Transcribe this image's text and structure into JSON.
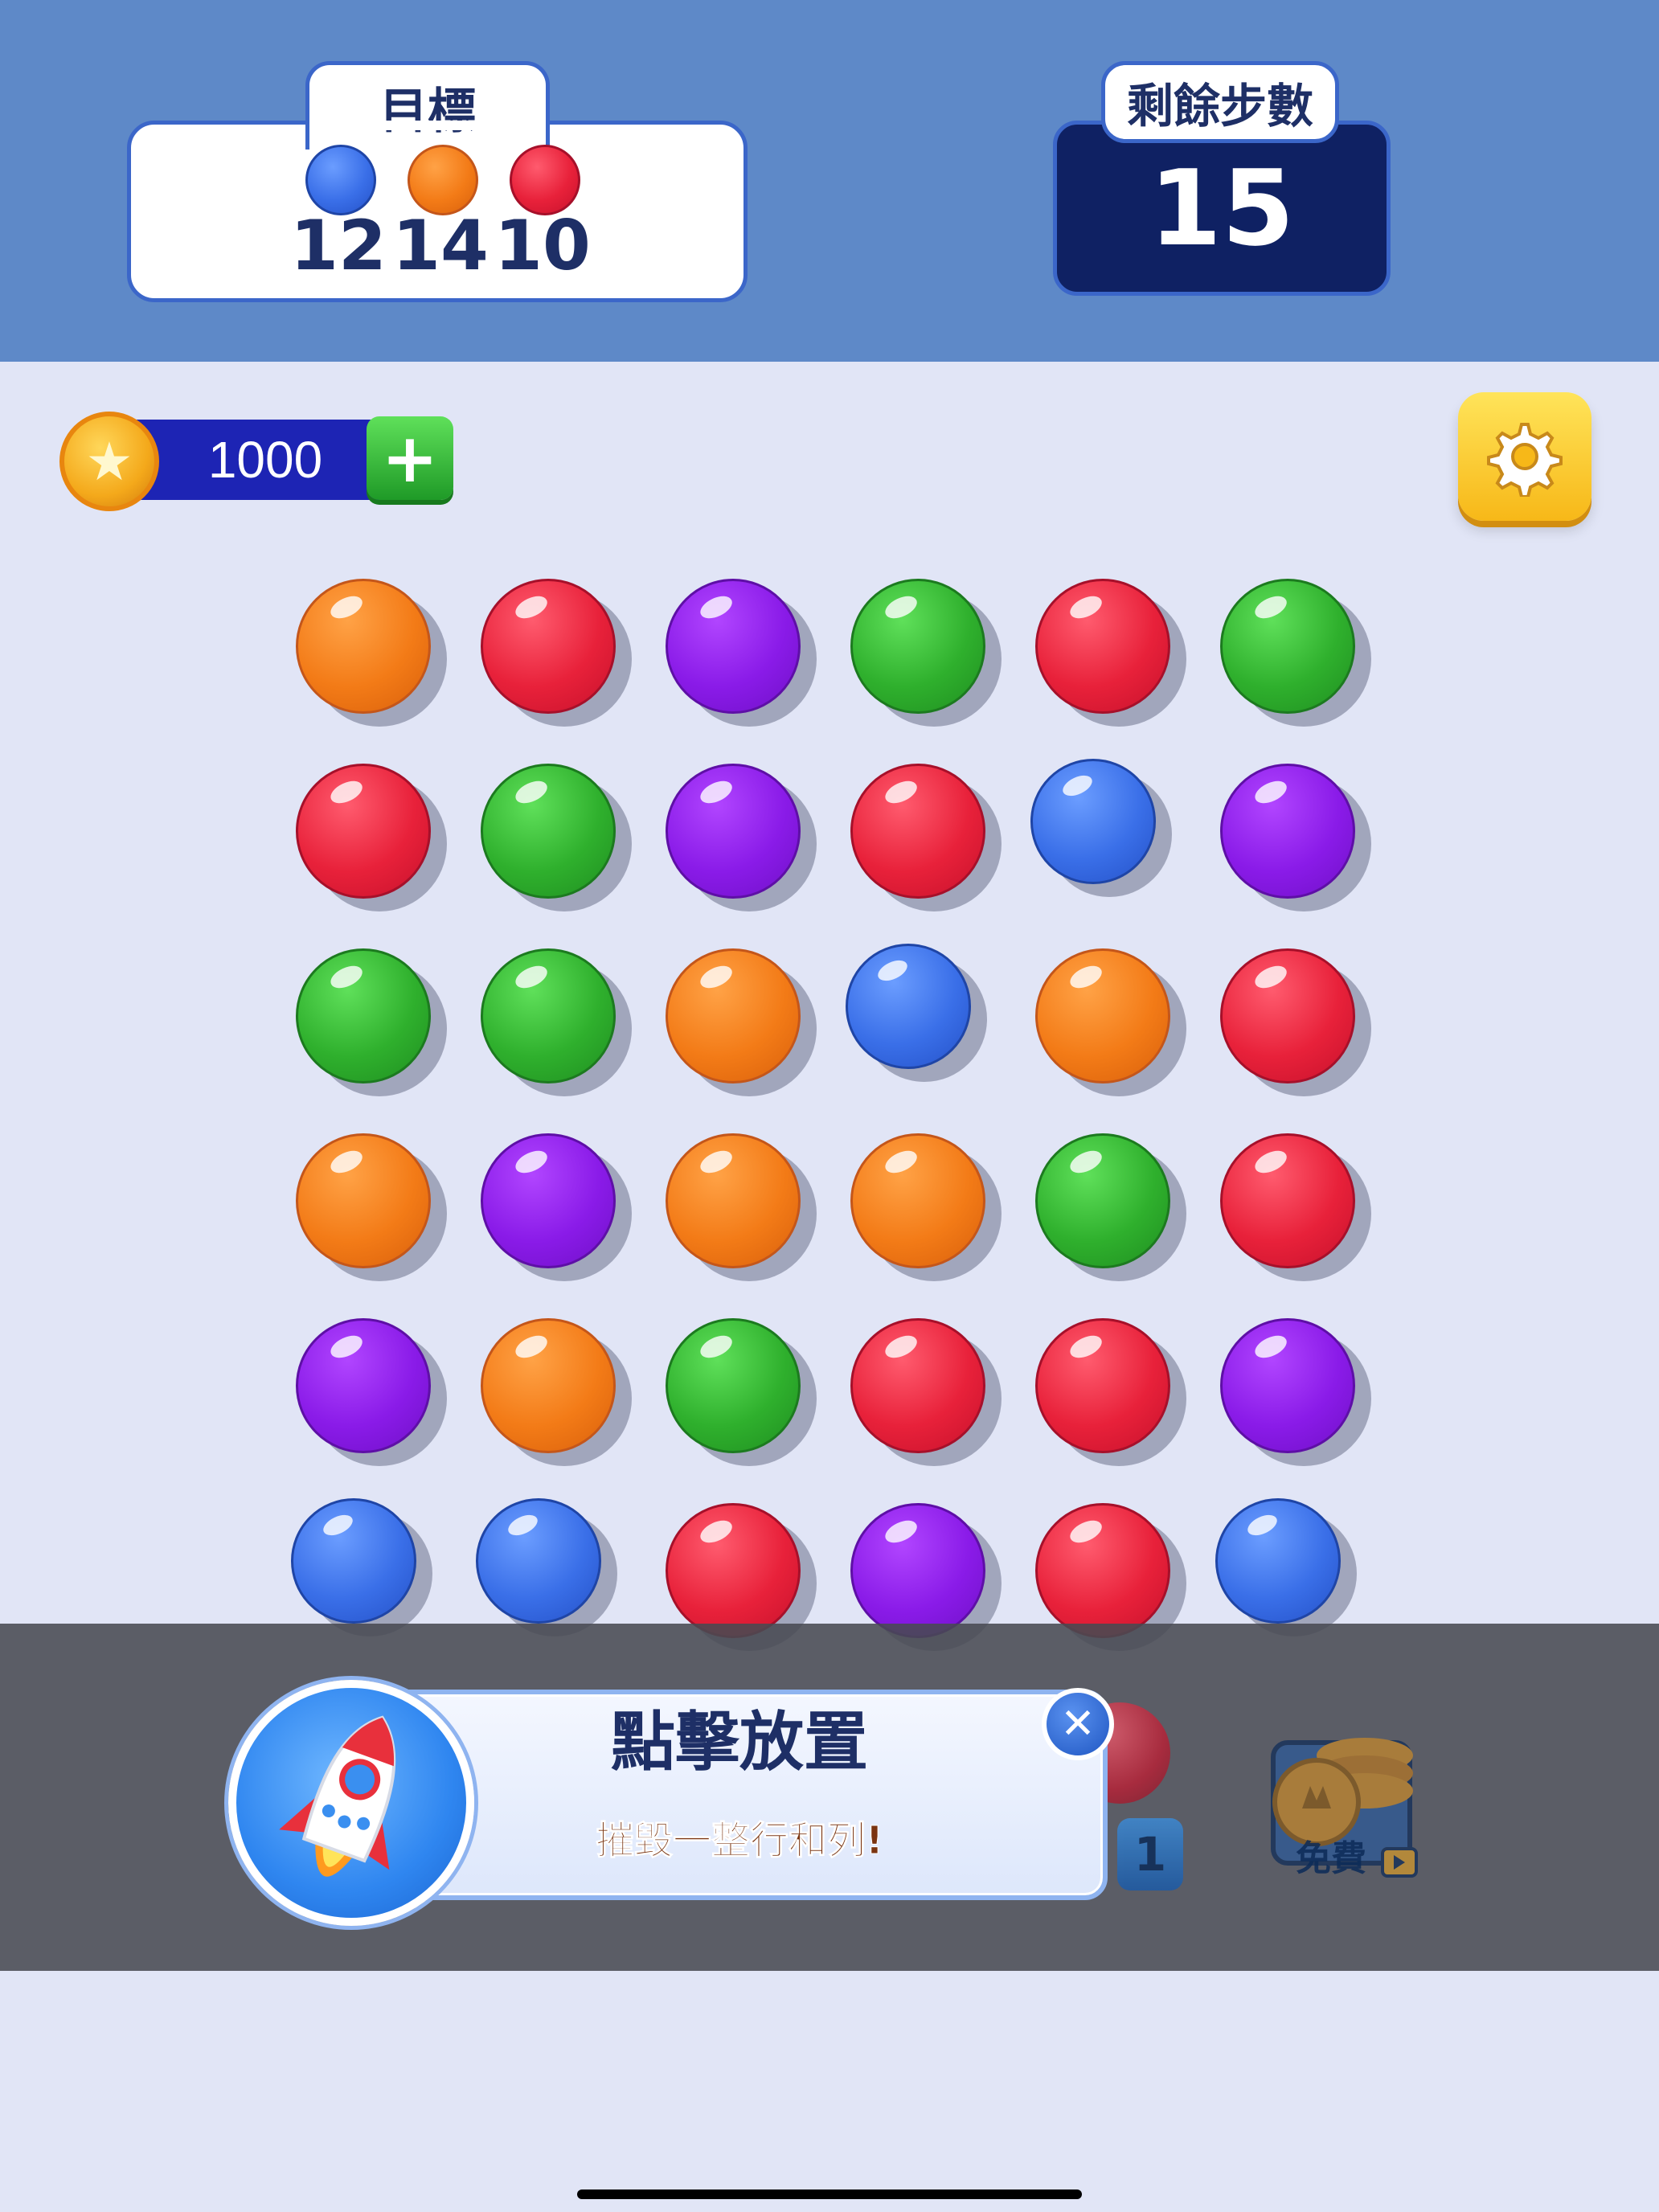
{
  "goal": {
    "title": "目標",
    "items": [
      {
        "color": "blue",
        "count": "12"
      },
      {
        "color": "orange",
        "count": "14"
      },
      {
        "color": "red",
        "count": "10"
      }
    ]
  },
  "moves": {
    "title": "剩餘步數",
    "value": "15"
  },
  "coins": {
    "value": "1000",
    "add_icon": "plus-icon",
    "coin_icon": "star-coin-icon"
  },
  "settings": {
    "icon": "gear-icon"
  },
  "board": {
    "rows": [
      [
        "orange",
        "red",
        "purple",
        "green",
        "red",
        "green"
      ],
      [
        "red",
        "green",
        "purple",
        "red",
        "blue",
        "purple"
      ],
      [
        "green",
        "green",
        "orange",
        "blue",
        "orange",
        "red"
      ],
      [
        "orange",
        "purple",
        "orange",
        "orange",
        "green",
        "red"
      ],
      [
        "purple",
        "orange",
        "green",
        "red",
        "red",
        "purple"
      ],
      [
        "blue",
        "blue",
        "red",
        "purple",
        "red",
        "blue"
      ]
    ]
  },
  "booster": {
    "icon": "rocket-icon",
    "title": "點擊放置",
    "description": "摧毀一整行和列!",
    "count": "1",
    "free_label": "免費"
  },
  "colors": {
    "top_bar": "#5e89c8",
    "background": "#e1e5f6",
    "navy": "#0f2163"
  }
}
